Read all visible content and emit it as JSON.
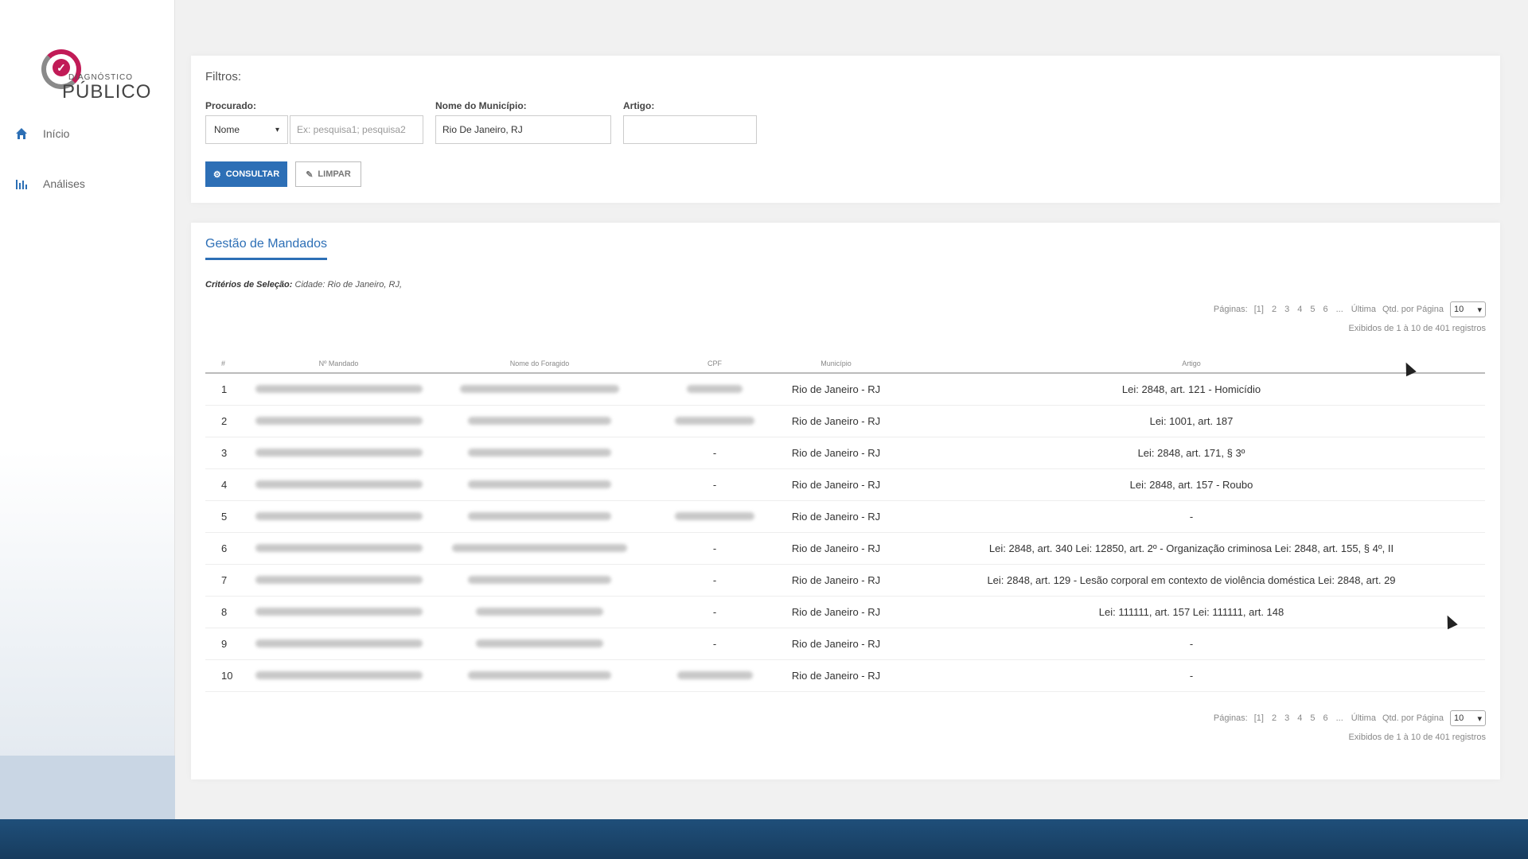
{
  "app": {
    "logo_top": "Diagnóstico",
    "logo_main": "PÚBLICO",
    "brand_color": "#2d6fb6",
    "logo_accent": "#c11b57"
  },
  "sidebar": {
    "items": [
      {
        "label": "Início",
        "icon": "home-icon"
      },
      {
        "label": "Análises",
        "icon": "bar-chart-icon"
      }
    ]
  },
  "filters": {
    "title": "Filtros:",
    "procurado_label": "Procurado:",
    "procurado_value": "Nome",
    "search_placeholder": "Ex: pesquisa1; pesquisa2",
    "municipio_label": "Nome do Município:",
    "municipio_value": "Rio De Janeiro, RJ",
    "artigo_label": "Artigo:",
    "artigo_value": "",
    "consultar_label": "Consultar",
    "limpar_label": "Limpar"
  },
  "table_section": {
    "title": "Gestão de Mandados",
    "criteria_label": "Critérios de Seleção:",
    "criteria_value": "Cidade: Rio de Janeiro, RJ,",
    "pager": {
      "label": "Páginas:",
      "pages": [
        "[1]",
        "2",
        "3",
        "4",
        "5",
        "6",
        "...",
        "Última"
      ],
      "per_page_label": "Qtd. por Página",
      "per_page_value": "10",
      "records_text": "Exibidos de 1 à 10 de 401 registros"
    },
    "columns": [
      "#",
      "Nº Mandado",
      "Nome do Foragido",
      "CPF",
      "Município",
      "Artigo"
    ],
    "rows": [
      {
        "n": "1",
        "cpf": "blur",
        "municipio": "Rio de Janeiro - RJ",
        "artigo": "Lei: 2848, art. 121 - Homicídio"
      },
      {
        "n": "2",
        "cpf": "blur",
        "municipio": "Rio de Janeiro - RJ",
        "artigo": "Lei: 1001, art. 187"
      },
      {
        "n": "3",
        "cpf": "-",
        "municipio": "Rio de Janeiro - RJ",
        "artigo": "Lei: 2848, art. 171, § 3º"
      },
      {
        "n": "4",
        "cpf": "-",
        "municipio": "Rio de Janeiro - RJ",
        "artigo": "Lei: 2848, art. 157 - Roubo"
      },
      {
        "n": "5",
        "cpf": "blur",
        "municipio": "Rio de Janeiro - RJ",
        "artigo": "-"
      },
      {
        "n": "6",
        "cpf": "-",
        "municipio": "Rio de Janeiro - RJ",
        "artigo": "Lei: 2848, art. 340 Lei: 12850, art. 2º - Organização criminosa Lei: 2848, art. 155, § 4º, II"
      },
      {
        "n": "7",
        "cpf": "-",
        "municipio": "Rio de Janeiro - RJ",
        "artigo": "Lei: 2848, art. 129 - Lesão corporal em contexto de violência doméstica Lei: 2848, art. 29"
      },
      {
        "n": "8",
        "cpf": "-",
        "municipio": "Rio de Janeiro - RJ",
        "artigo": "Lei: 111111, art. 157 Lei: 111111, art. 148"
      },
      {
        "n": "9",
        "cpf": "-",
        "municipio": "Rio de Janeiro - RJ",
        "artigo": "-"
      },
      {
        "n": "10",
        "cpf": "blur",
        "municipio": "Rio de Janeiro - RJ",
        "artigo": "-"
      }
    ]
  }
}
